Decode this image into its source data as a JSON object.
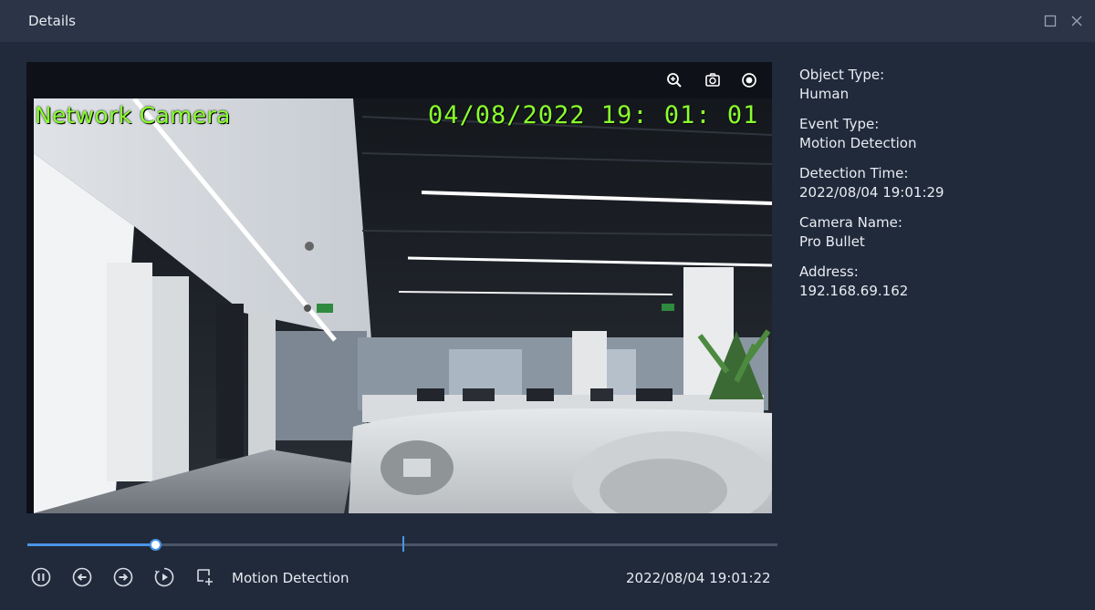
{
  "window": {
    "title": "Details"
  },
  "video": {
    "overlay_camera_text": "Network Camera",
    "overlay_timestamp": "04/08/2022 19: 01: 01",
    "toolbar": [
      {
        "icon": "zoom-in-icon"
      },
      {
        "icon": "snapshot-icon"
      },
      {
        "icon": "record-icon"
      }
    ]
  },
  "playback": {
    "progress": 0.17,
    "marker": 0.5,
    "event_label": "Motion Detection",
    "clip_time": "2022/08/04 19:01:22",
    "controls": [
      "pause-icon",
      "previous-icon",
      "next-icon",
      "play-icon",
      "add-filter-icon"
    ]
  },
  "details": {
    "fields": [
      {
        "label": "Object Type:",
        "value": "Human"
      },
      {
        "label": "Event Type:",
        "value": "Motion Detection"
      },
      {
        "label": "Detection Time:",
        "value": "2022/08/04 19:01:29"
      },
      {
        "label": "Camera Name:",
        "value": "Pro Bullet"
      },
      {
        "label": "Address:",
        "value": "192.168.69.162"
      }
    ]
  },
  "colors": {
    "accent": "#4a95e6",
    "background": "#212a3b",
    "titlebar": "#2b3547",
    "overlay_text": "#8aff2e"
  }
}
